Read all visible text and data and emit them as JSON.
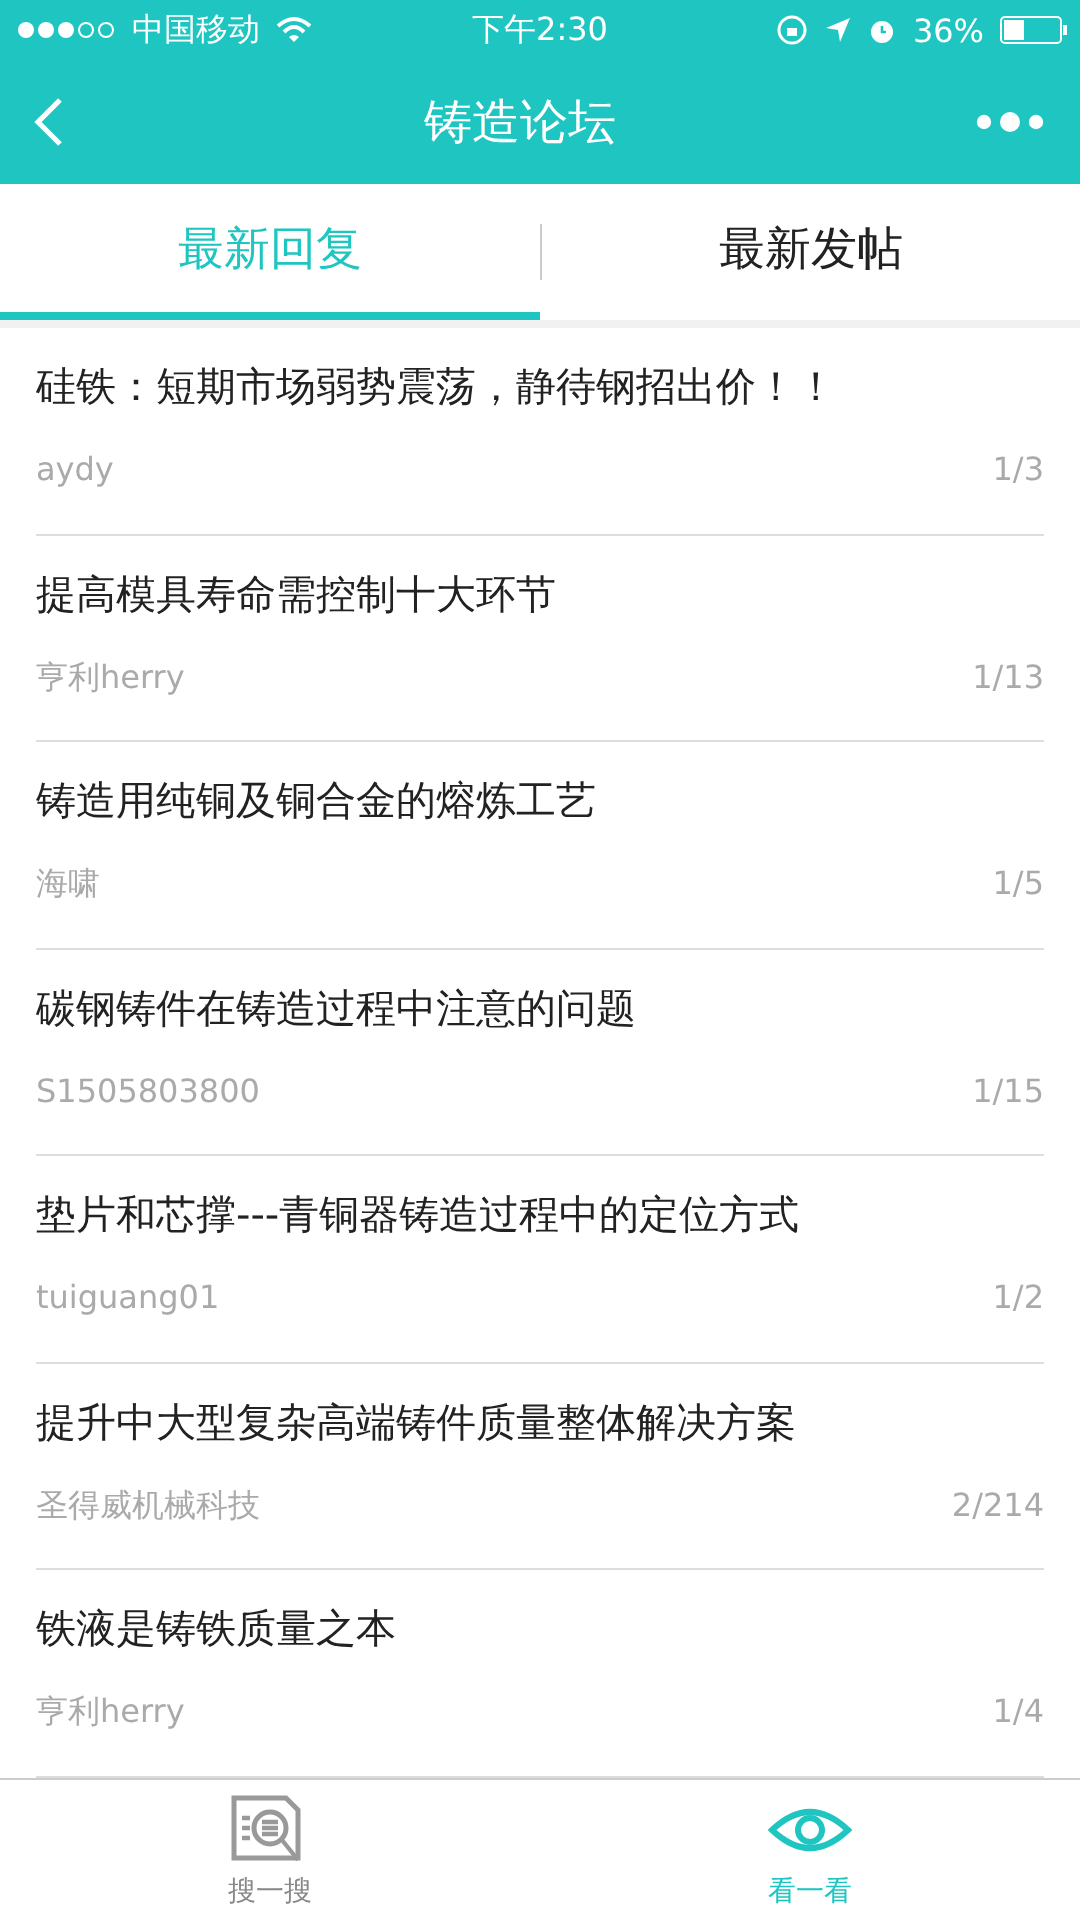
{
  "status_bar": {
    "carrier": "中国移动",
    "time": "下午2:30",
    "battery": "36%"
  },
  "nav": {
    "title": "铸造论坛"
  },
  "tabs": [
    {
      "label": "最新回复",
      "selected": true
    },
    {
      "label": "最新发帖",
      "selected": false
    }
  ],
  "posts": [
    {
      "title": "硅铁：短期市场弱势震荡，静待钢招出价！！",
      "author": "aydy",
      "pages": "1/3"
    },
    {
      "title": "提高模具寿命需控制十大环节",
      "author": "亨利herry",
      "pages": "1/13"
    },
    {
      "title": "铸造用纯铜及铜合金的熔炼工艺",
      "author": "海啸",
      "pages": "1/5"
    },
    {
      "title": "碳钢铸件在铸造过程中注意的问题",
      "author": "S1505803800",
      "pages": "1/15"
    },
    {
      "title": "垫片和芯撑---青铜器铸造过程中的定位方式",
      "author": "tuiguang01",
      "pages": "1/2"
    },
    {
      "title": "提升中大型复杂高端铸件质量整体解决方案",
      "author": "圣得威机械科技",
      "pages": "2/214"
    },
    {
      "title": "铁液是铸铁质量之本",
      "author": "亨利herry",
      "pages": "1/4"
    }
  ],
  "bottom_tabs": [
    {
      "kind": "search",
      "label": "搜一搜",
      "selected": false
    },
    {
      "kind": "look",
      "label": "看一看",
      "selected": true
    }
  ]
}
